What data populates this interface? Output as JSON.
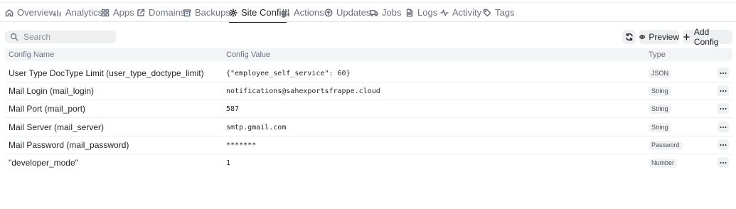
{
  "tabs": [
    {
      "label": "Overview",
      "icon": "home-icon"
    },
    {
      "label": "Analytics",
      "icon": "bar-chart-icon"
    },
    {
      "label": "Apps",
      "icon": "grid-icon"
    },
    {
      "label": "Domains",
      "icon": "external-link-icon"
    },
    {
      "label": "Backups",
      "icon": "archive-icon"
    },
    {
      "label": "Site Config",
      "icon": "gear-icon",
      "active": true
    },
    {
      "label": "Actions",
      "icon": "sliders-icon"
    },
    {
      "label": "Updates",
      "icon": "arrow-up-circle-icon"
    },
    {
      "label": "Jobs",
      "icon": "truck-icon"
    },
    {
      "label": "Logs",
      "icon": "file-text-icon"
    },
    {
      "label": "Activity",
      "icon": "activity-icon"
    },
    {
      "label": "Tags",
      "icon": "tag-icon"
    }
  ],
  "toolbar": {
    "search_placeholder": "Search",
    "preview_label": "Preview",
    "add_config_label": "Add Config"
  },
  "table": {
    "headers": {
      "name": "Config Name",
      "value": "Config Value",
      "type": "Type"
    },
    "rows": [
      {
        "name": "User Type DocType Limit (user_type_doctype_limit)",
        "value": "{\"employee_self_service\": 60}",
        "type": "JSON"
      },
      {
        "name": "Mail Login (mail_login)",
        "value": "notifications@sahexportsfrappe.cloud",
        "type": "String"
      },
      {
        "name": "Mail Port (mail_port)",
        "value": "587",
        "type": "String"
      },
      {
        "name": "Mail Server (mail_server)",
        "value": "smtp.gmail.com",
        "type": "String"
      },
      {
        "name": "Mail Password (mail_password)",
        "value": "*******",
        "type": "Password"
      },
      {
        "name": "\"developer_mode\"",
        "value": "1",
        "type": "Number"
      }
    ]
  }
}
